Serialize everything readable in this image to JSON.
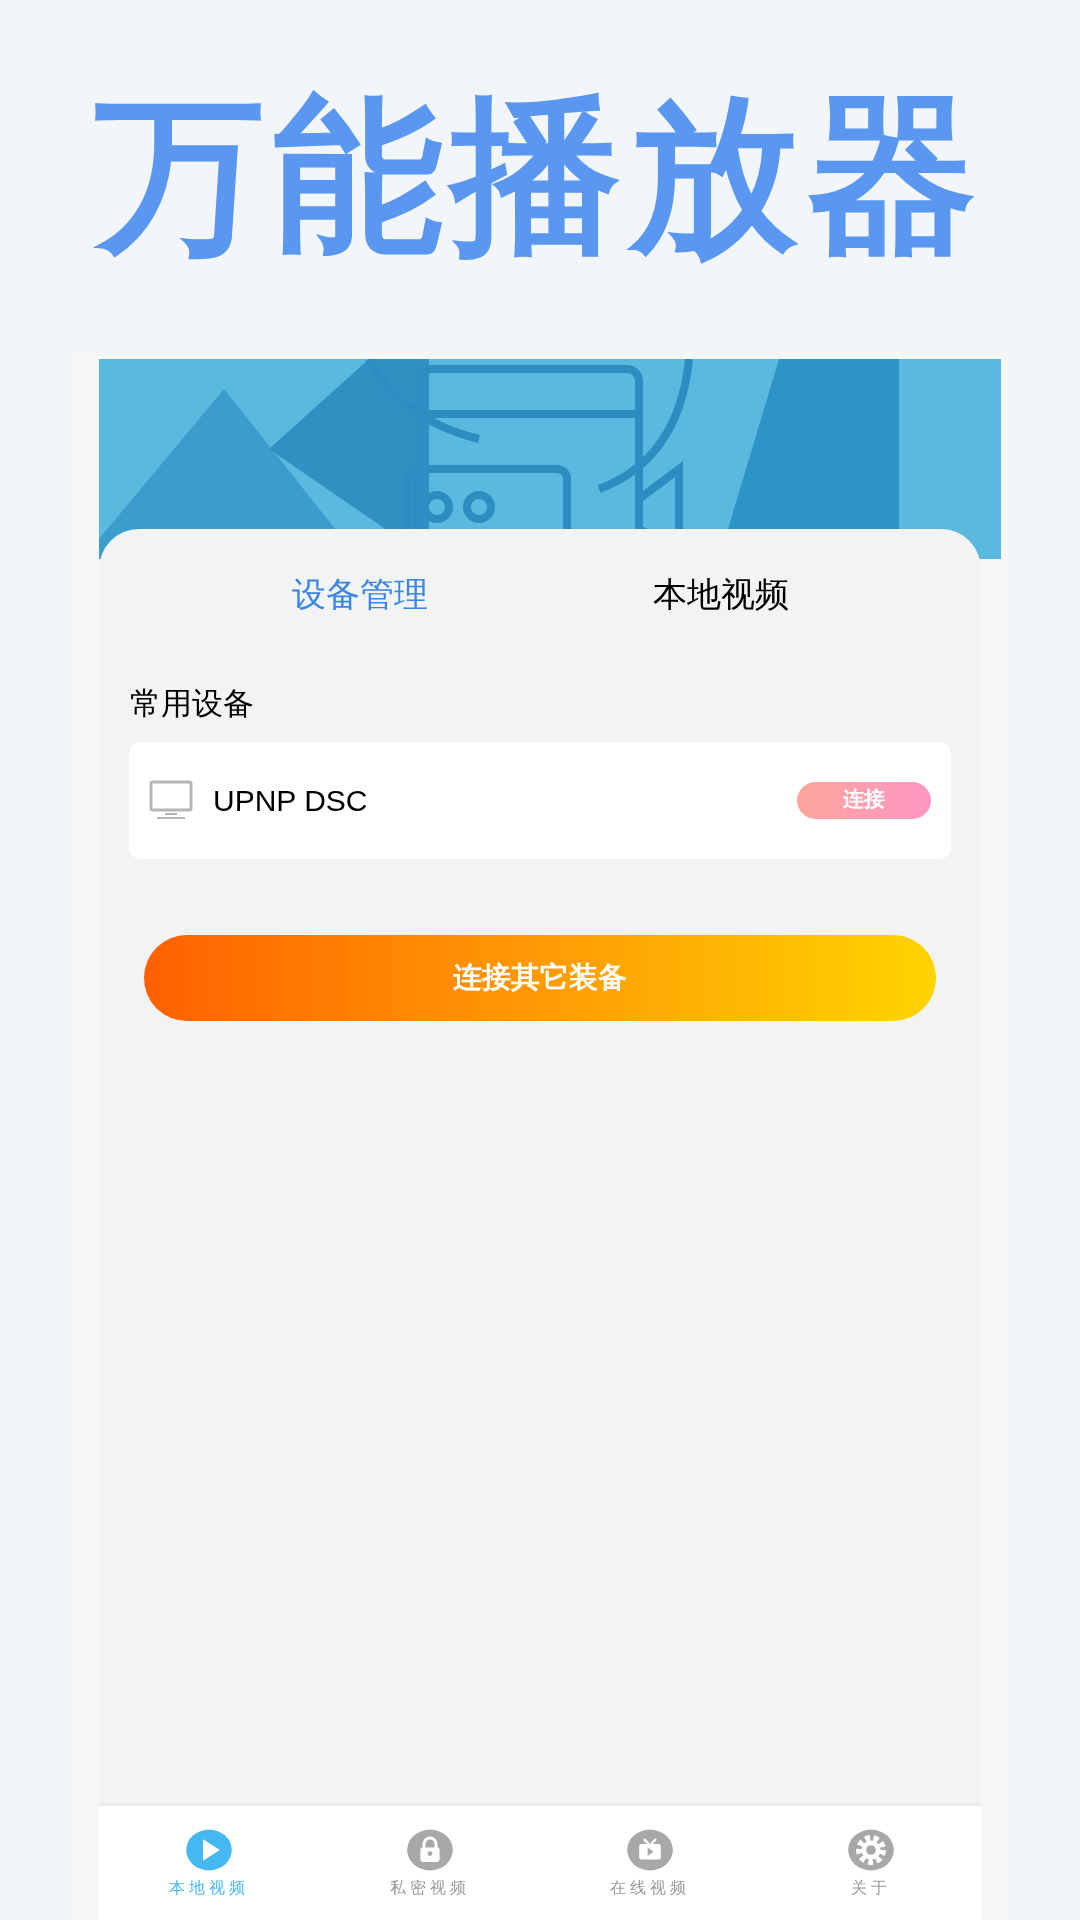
{
  "promo_title": "万能播放器",
  "tabs": [
    {
      "label": "设备管理",
      "selected": true
    },
    {
      "label": "本地视频",
      "selected": false
    }
  ],
  "section_title": "常用设备",
  "devices": [
    {
      "name": "UPNP DSC",
      "action": "连接"
    }
  ],
  "connect_other_button": "连接其它装备",
  "bottom_nav": [
    {
      "label": "本地视频",
      "kind": "play",
      "selected": true
    },
    {
      "label": "私密视频",
      "kind": "lock",
      "selected": false
    },
    {
      "label": "在线视频",
      "kind": "tv",
      "selected": false
    },
    {
      "label": "关于",
      "kind": "gear",
      "selected": false
    }
  ]
}
